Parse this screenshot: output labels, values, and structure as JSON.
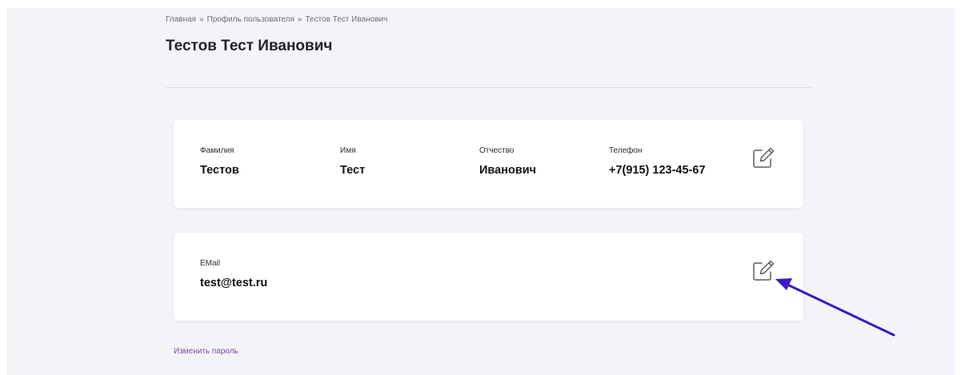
{
  "breadcrumb": {
    "items": [
      "Главная",
      "Профиль пользователя",
      "Тестов Тест Иванович"
    ],
    "separator": "»"
  },
  "page_title": "Тестов Тест Иванович",
  "profile_card": {
    "fields": [
      {
        "label": "Фамилия",
        "value": "Тестов"
      },
      {
        "label": "Имя",
        "value": "Тест"
      },
      {
        "label": "Отчество",
        "value": "Иванович"
      },
      {
        "label": "Телефон",
        "value": "+7(915) 123-45-67"
      }
    ],
    "edit_icon": "pencil-square-icon"
  },
  "email_card": {
    "label": "EMail",
    "value": "test@test.ru",
    "edit_icon": "pencil-square-icon"
  },
  "change_password_link": "Изменить пароль",
  "annotation": {
    "icon": "arrow-annotation",
    "color": "#3d18c9"
  },
  "colors": {
    "page_background": "#f3f4f8",
    "card_background": "#ffffff",
    "link": "#7a4aa8"
  }
}
